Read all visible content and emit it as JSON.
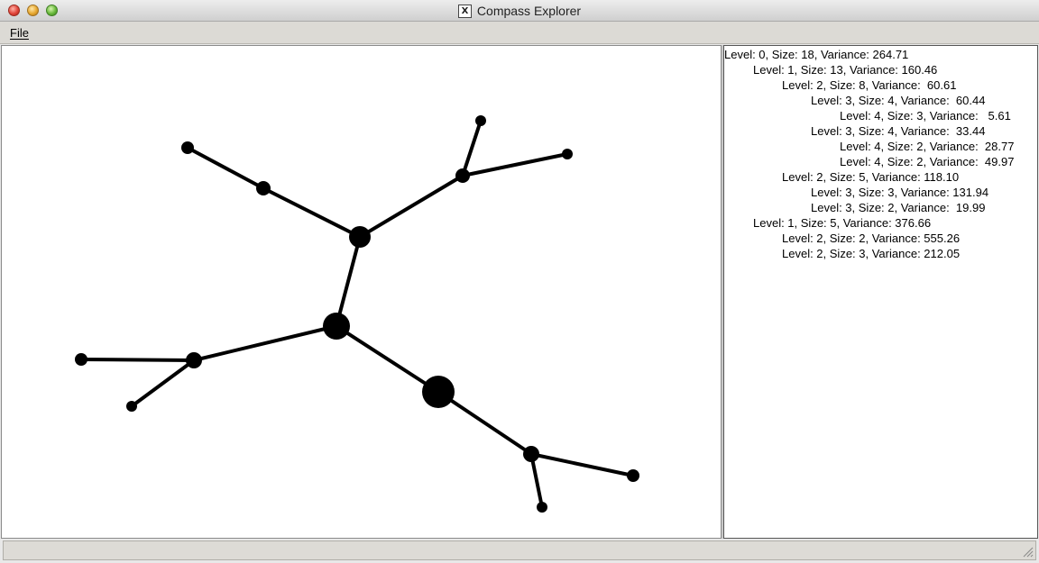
{
  "window": {
    "title": "Compass Explorer",
    "x_glyph": "X"
  },
  "menu": {
    "items": [
      {
        "label": "File"
      }
    ]
  },
  "tree": {
    "rows": [
      {
        "level": 0,
        "text": "Level: 0, Size: 18, Variance: 264.71"
      },
      {
        "level": 1,
        "text": "Level: 1, Size: 13, Variance: 160.46"
      },
      {
        "level": 2,
        "text": "Level: 2, Size: 8, Variance:  60.61"
      },
      {
        "level": 3,
        "text": "Level: 3, Size: 4, Variance:  60.44"
      },
      {
        "level": 4,
        "text": "Level: 4, Size: 3, Variance:   5.61"
      },
      {
        "level": 3,
        "text": "Level: 3, Size: 4, Variance:  33.44"
      },
      {
        "level": 4,
        "text": "Level: 4, Size: 2, Variance:  28.77"
      },
      {
        "level": 4,
        "text": "Level: 4, Size: 2, Variance:  49.97"
      },
      {
        "level": 2,
        "text": "Level: 2, Size: 5, Variance: 118.10"
      },
      {
        "level": 3,
        "text": "Level: 3, Size: 3, Variance: 131.94"
      },
      {
        "level": 3,
        "text": "Level: 3, Size: 2, Variance:  19.99"
      },
      {
        "level": 1,
        "text": "Level: 1, Size: 5, Variance: 376.66"
      },
      {
        "level": 2,
        "text": "Level: 2, Size: 2, Variance: 555.26"
      },
      {
        "level": 2,
        "text": "Level: 2, Size: 3, Variance: 212.05"
      }
    ]
  },
  "graph": {
    "node_color": "#000000",
    "edge_color": "#000000"
  }
}
